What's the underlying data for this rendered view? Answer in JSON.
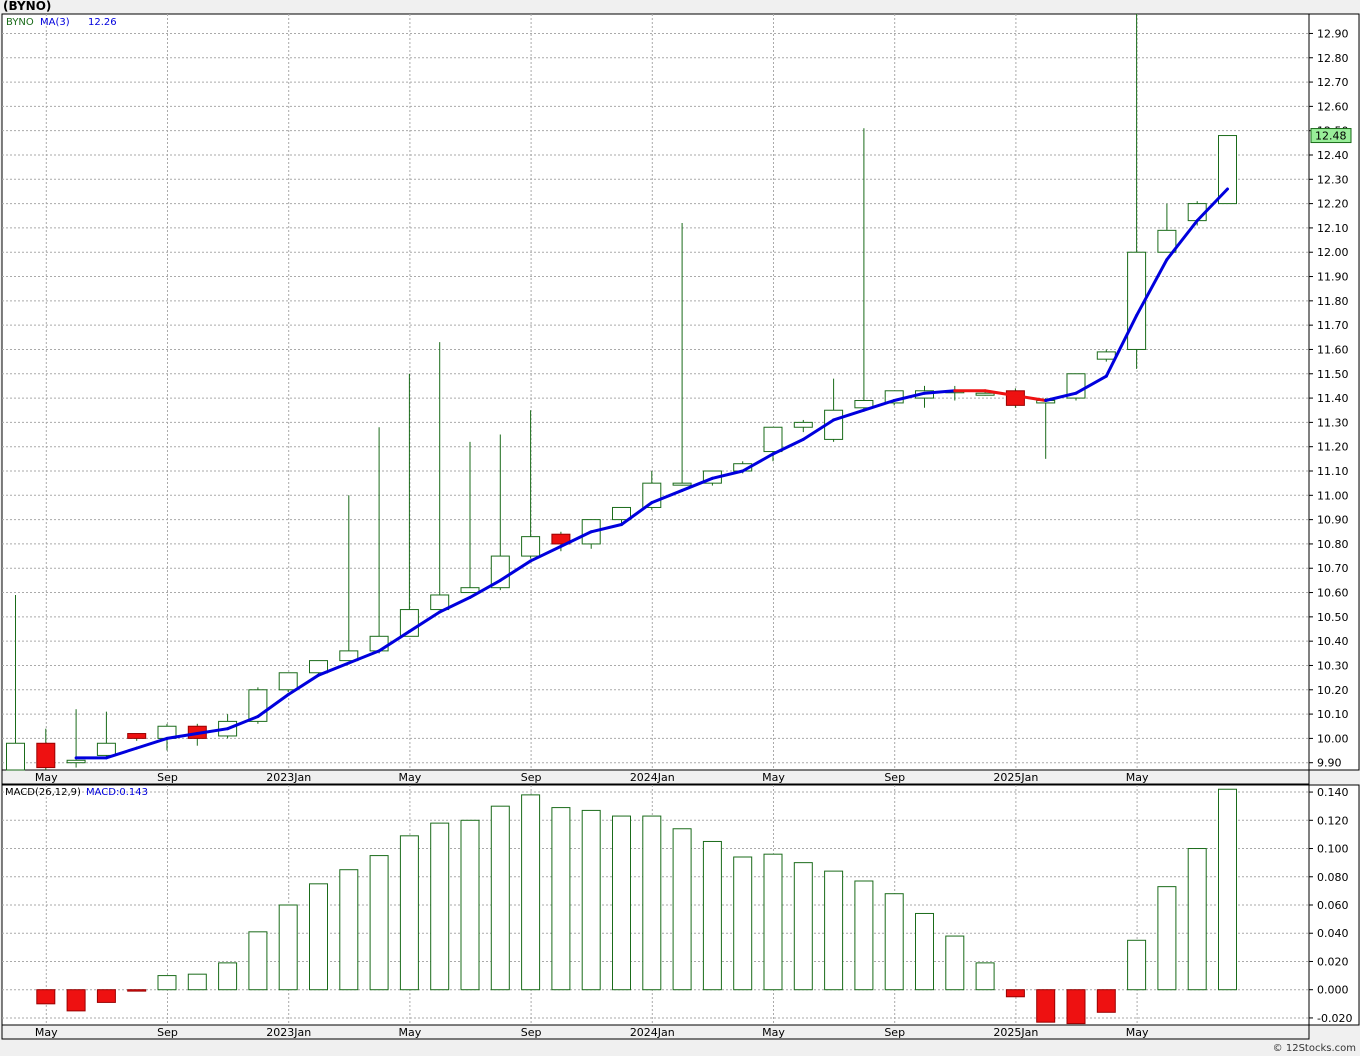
{
  "title": "(BYNO)",
  "watermark": "© 12Stocks.com",
  "price_panel": {
    "symbol_label": "BYNO",
    "ma_label": "MA(3)",
    "ma_value": "12.26",
    "last_price_badge": "12.48"
  },
  "macd_panel": {
    "label": "MACD(26,12,9)",
    "value_label": "MACD:0.143"
  },
  "colors": {
    "up_body": "#ffffff",
    "up_border": "#1a6b1a",
    "down_body": "#ee1111",
    "ma_up": "#0000dd",
    "ma_down": "#ee1111",
    "grid": "#aaaaaa",
    "badge_fill": "#99ee99"
  },
  "chart_data": [
    {
      "type": "candlestick",
      "title": "(BYNO)",
      "ylim": [
        9.87,
        12.98
      ],
      "yticks": [
        "9.90",
        "10.00",
        "10.10",
        "10.20",
        "10.30",
        "10.40",
        "10.50",
        "10.60",
        "10.70",
        "10.80",
        "10.90",
        "11.00",
        "11.10",
        "11.20",
        "11.30",
        "11.40",
        "11.50",
        "11.60",
        "11.70",
        "11.80",
        "11.90",
        "12.00",
        "12.10",
        "12.20",
        "12.30",
        "12.40",
        "12.50",
        "12.60",
        "12.70",
        "12.80",
        "12.90"
      ],
      "x_tick_labels": [
        {
          "label": "May",
          "index": 1
        },
        {
          "label": "Sep",
          "index": 5
        },
        {
          "label": "2023Jan",
          "index": 9
        },
        {
          "label": "May",
          "index": 13
        },
        {
          "label": "Sep",
          "index": 17
        },
        {
          "label": "2024Jan",
          "index": 21
        },
        {
          "label": "May",
          "index": 25
        },
        {
          "label": "Sep",
          "index": 29
        },
        {
          "label": "2025Jan",
          "index": 33
        },
        {
          "label": "May",
          "index": 37
        }
      ],
      "candles": [
        {
          "o": 9.87,
          "h": 10.59,
          "l": 9.87,
          "c": 9.98
        },
        {
          "o": 9.98,
          "h": 10.04,
          "l": 9.87,
          "c": 9.88
        },
        {
          "o": 9.9,
          "h": 10.12,
          "l": 9.88,
          "c": 9.91
        },
        {
          "o": 9.93,
          "h": 10.11,
          "l": 9.92,
          "c": 9.98
        },
        {
          "o": 10.02,
          "h": 10.02,
          "l": 9.99,
          "c": 10.0
        },
        {
          "o": 10.0,
          "h": 10.06,
          "l": 9.95,
          "c": 10.05
        },
        {
          "o": 10.05,
          "h": 10.06,
          "l": 9.97,
          "c": 10.0
        },
        {
          "o": 10.01,
          "h": 10.1,
          "l": 10.0,
          "c": 10.07
        },
        {
          "o": 10.07,
          "h": 10.21,
          "l": 10.06,
          "c": 10.2
        },
        {
          "o": 10.2,
          "h": 10.27,
          "l": 10.19,
          "c": 10.27
        },
        {
          "o": 10.27,
          "h": 10.32,
          "l": 10.26,
          "c": 10.32
        },
        {
          "o": 10.32,
          "h": 11.0,
          "l": 10.32,
          "c": 10.36
        },
        {
          "o": 10.36,
          "h": 11.28,
          "l": 10.35,
          "c": 10.42
        },
        {
          "o": 10.42,
          "h": 11.5,
          "l": 10.42,
          "c": 10.53
        },
        {
          "o": 10.53,
          "h": 11.63,
          "l": 10.53,
          "c": 10.59
        },
        {
          "o": 10.6,
          "h": 11.22,
          "l": 10.6,
          "c": 10.62
        },
        {
          "o": 10.62,
          "h": 11.25,
          "l": 10.61,
          "c": 10.75
        },
        {
          "o": 10.75,
          "h": 11.35,
          "l": 10.74,
          "c": 10.83
        },
        {
          "o": 10.84,
          "h": 10.85,
          "l": 10.77,
          "c": 10.8
        },
        {
          "o": 10.8,
          "h": 10.9,
          "l": 10.78,
          "c": 10.9
        },
        {
          "o": 10.9,
          "h": 10.95,
          "l": 10.88,
          "c": 10.95
        },
        {
          "o": 10.95,
          "h": 11.1,
          "l": 10.94,
          "c": 11.05
        },
        {
          "o": 11.05,
          "h": 12.12,
          "l": 11.04,
          "c": 11.05
        },
        {
          "o": 11.05,
          "h": 11.1,
          "l": 11.04,
          "c": 11.1
        },
        {
          "o": 11.1,
          "h": 11.14,
          "l": 11.09,
          "c": 11.13
        },
        {
          "o": 11.18,
          "h": 11.28,
          "l": 11.14,
          "c": 11.28
        },
        {
          "o": 11.28,
          "h": 11.31,
          "l": 11.26,
          "c": 11.3
        },
        {
          "o": 11.23,
          "h": 11.48,
          "l": 11.22,
          "c": 11.35
        },
        {
          "o": 11.36,
          "h": 12.51,
          "l": 11.35,
          "c": 11.39
        },
        {
          "o": 11.38,
          "h": 11.43,
          "l": 11.37,
          "c": 11.43
        },
        {
          "o": 11.4,
          "h": 11.45,
          "l": 11.36,
          "c": 11.43
        },
        {
          "o": 11.43,
          "h": 11.45,
          "l": 11.39,
          "c": 11.43
        },
        {
          "o": 11.42,
          "h": 11.43,
          "l": 11.41,
          "c": 11.42
        },
        {
          "o": 11.43,
          "h": 11.44,
          "l": 11.36,
          "c": 11.37
        },
        {
          "o": 11.38,
          "h": 11.4,
          "l": 11.15,
          "c": 11.39
        },
        {
          "o": 11.4,
          "h": 11.5,
          "l": 11.39,
          "c": 11.5
        },
        {
          "o": 11.56,
          "h": 11.6,
          "l": 11.55,
          "c": 11.59
        },
        {
          "o": 11.6,
          "h": 12.98,
          "l": 11.52,
          "c": 12.0
        },
        {
          "o": 12.0,
          "h": 12.2,
          "l": 12.0,
          "c": 12.09
        },
        {
          "o": 12.13,
          "h": 12.21,
          "l": 12.11,
          "c": 12.2
        },
        {
          "o": 12.2,
          "h": 12.48,
          "l": 12.2,
          "c": 12.48
        }
      ],
      "ma3": [
        null,
        null,
        9.92,
        9.92,
        9.96,
        10.0,
        10.02,
        10.04,
        10.09,
        10.18,
        10.26,
        10.31,
        10.36,
        10.44,
        10.52,
        10.58,
        10.65,
        10.73,
        10.79,
        10.85,
        10.88,
        10.97,
        11.02,
        11.07,
        11.1,
        11.17,
        11.23,
        11.31,
        11.35,
        11.39,
        11.42,
        11.43,
        11.43,
        11.41,
        11.39,
        11.42,
        11.49,
        11.74,
        11.97,
        12.13,
        12.26
      ],
      "ma_direction": [
        "up",
        "up",
        "down",
        "up",
        "up",
        "up",
        "up",
        "up",
        "up",
        "up",
        "up",
        "up",
        "up",
        "up",
        "up",
        "up",
        "up",
        "up",
        "up",
        "up",
        "up",
        "up",
        "up",
        "up",
        "up",
        "up",
        "up",
        "up",
        "up",
        "up",
        "up",
        "up",
        "down",
        "down",
        "down",
        "up",
        "up",
        "up",
        "up",
        "up",
        "up"
      ]
    },
    {
      "type": "bar",
      "title": "MACD(26,12,9)",
      "ylim": [
        -0.025,
        0.145
      ],
      "yticks": [
        "-0.020",
        "0.000",
        "0.020",
        "0.040",
        "0.060",
        "0.080",
        "0.100",
        "0.120",
        "0.140"
      ],
      "x_tick_labels": [
        {
          "label": "May",
          "index": 1
        },
        {
          "label": "Sep",
          "index": 5
        },
        {
          "label": "2023Jan",
          "index": 9
        },
        {
          "label": "May",
          "index": 13
        },
        {
          "label": "Sep",
          "index": 17
        },
        {
          "label": "2024Jan",
          "index": 21
        },
        {
          "label": "May",
          "index": 25
        },
        {
          "label": "Sep",
          "index": 29
        },
        {
          "label": "2025Jan",
          "index": 33
        },
        {
          "label": "May",
          "index": 37
        }
      ],
      "values": [
        null,
        -0.01,
        -0.015,
        -0.009,
        -0.001,
        0.01,
        0.011,
        0.019,
        0.041,
        0.06,
        0.075,
        0.085,
        0.095,
        0.109,
        0.118,
        0.12,
        0.13,
        0.138,
        0.129,
        0.127,
        0.123,
        0.123,
        0.114,
        0.105,
        0.094,
        0.096,
        0.09,
        0.084,
        0.077,
        0.068,
        0.054,
        0.038,
        0.019,
        -0.005,
        -0.023,
        -0.024,
        -0.016,
        0.035,
        0.073,
        0.1,
        0.142
      ]
    }
  ]
}
